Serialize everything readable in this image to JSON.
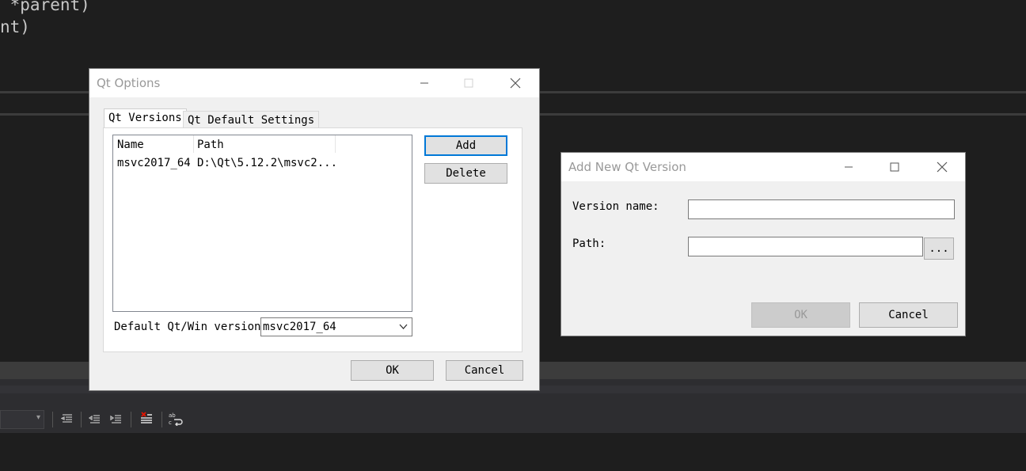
{
  "background_code": {
    "line1": " *parent)",
    "line2": "nt)"
  },
  "qt_options": {
    "title": "Qt Options",
    "tabs": [
      "Qt Versions",
      "Qt Default Settings"
    ],
    "columns": [
      "Name",
      "Path"
    ],
    "rows": [
      {
        "name": "msvc2017_64",
        "path": "D:\\Qt\\5.12.2\\msvc2..."
      }
    ],
    "add_label": "Add",
    "delete_label": "Delete",
    "default_label": "Default Qt/Win version:",
    "default_value": "msvc2017_64",
    "ok_label": "OK",
    "cancel_label": "Cancel"
  },
  "add_dialog": {
    "title": "Add New Qt Version",
    "version_name_label": "Version name:",
    "version_name_value": "",
    "path_label": "Path:",
    "path_value": "",
    "browse_label": "...",
    "ok_label": "OK",
    "cancel_label": "Cancel"
  },
  "colors": {
    "ide_background": "#1e1e1e",
    "dialog_background": "#f0f0f0",
    "default_button_border": "#0078d7"
  },
  "icons": [
    "minimize-icon",
    "maximize-icon",
    "close-icon",
    "chevron-down-icon",
    "dropdown-arrow-icon",
    "outdent-icon",
    "indent-icon",
    "remove-breakpoints-icon",
    "word-wrap-icon"
  ]
}
